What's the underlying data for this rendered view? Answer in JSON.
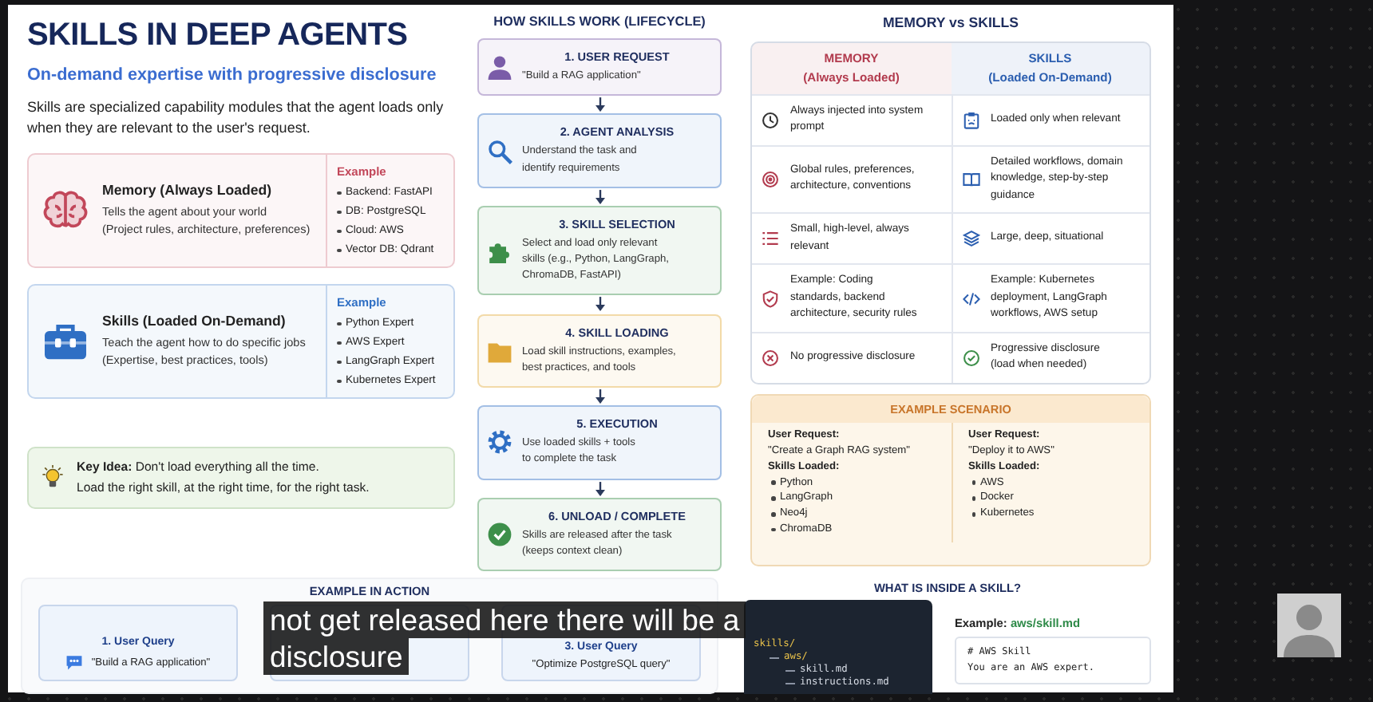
{
  "header": {
    "title": "SKILLS IN DEEP AGENTS",
    "subtitle": "On-demand expertise with progressive disclosure",
    "description": "Skills are specialized capability modules that the agent loads only when they are relevant to the user's request."
  },
  "concepts": [
    {
      "title": "Memory (Always Loaded)",
      "lines": [
        "Tells the agent about your world",
        "(Project rules, architecture, preferences)"
      ],
      "example_label": "Example",
      "examples": [
        "Backend: FastAPI",
        "DB: PostgreSQL",
        "Cloud: AWS",
        "Vector DB: Qdrant"
      ],
      "color": "#c2475a"
    },
    {
      "title": "Skills (Loaded On-Demand)",
      "lines": [
        "Teach the agent how to do specific jobs",
        "(Expertise, best practices, tools)"
      ],
      "example_label": "Example",
      "examples": [
        "Python Expert",
        "AWS Expert",
        "LangGraph Expert",
        "Kubernetes Expert"
      ],
      "color": "#2f6fc4"
    }
  ],
  "key_idea": {
    "lines": [
      "**Key Idea:**  Don't load everything all the time.",
      "Load the right skill, at the right time, for the right task."
    ]
  },
  "lifecycle": {
    "title": "HOW SKILLS WORK (LIFECYCLE)",
    "steps": [
      {
        "title": "1.  USER REQUEST",
        "lines": [
          "\"Build a RAG application\""
        ],
        "color": "#7a5ca8"
      },
      {
        "title": "2.  AGENT ANALYSIS",
        "lines": [
          "Understand the task and",
          "identify requirements"
        ],
        "color": "#2f6fc4"
      },
      {
        "title": "3.  SKILL SELECTION",
        "lines": [
          "Select and load only relevant",
          "skills (e.g., Python, LangGraph,",
          "ChromaDB, FastAPI)"
        ],
        "color": "#3d8f4a"
      },
      {
        "title": "4.  SKILL LOADING",
        "lines": [
          "Load skill instructions, examples,",
          "best practices, and tools"
        ],
        "color": "#e0a93a"
      },
      {
        "title": "5.  EXECUTION",
        "lines": [
          "Use loaded skills + tools",
          "to complete the task"
        ],
        "color": "#2f6fc4"
      },
      {
        "title": "6. UNLOAD / COMPLETE",
        "lines": [
          "Skills are released after the task",
          "(keeps context clean)"
        ],
        "color": "#3d8f4a"
      }
    ]
  },
  "comparison": {
    "title": "MEMORY vs SKILLS",
    "columns": [
      {
        "title": "MEMORY",
        "subtitle": "(Always Loaded)",
        "color": "#b23b4e"
      },
      {
        "title": "SKILLS",
        "subtitle": "(Loaded On-Demand)",
        "color": "#2c5fb0"
      }
    ],
    "rows": [
      {
        "memory": "Always injected into system prompt",
        "skills": "Loaded only when relevant"
      },
      {
        "memory": "Global rules, preferences, architecture, conventions",
        "skills": "Detailed workflows, domain knowledge, step-by-step guidance"
      },
      {
        "memory": "Small, high-level, always relevant",
        "skills": "Large, deep, situational"
      },
      {
        "memory": "Example: Coding standards, backend architecture, security rules",
        "skills": "Example: Kubernetes deployment, LangGraph workflows, AWS setup"
      },
      {
        "memory": "No progressive disclosure",
        "skills": "Progressive disclosure (load when needed)"
      }
    ]
  },
  "scenario": {
    "title": "EXAMPLE SCENARIO",
    "cases": [
      {
        "request_label": "User Request:",
        "request": "\"Create a Graph RAG system\"",
        "skills_label": "Skills Loaded:",
        "skills": [
          "Python",
          "LangGraph",
          "Neo4j",
          "ChromaDB"
        ]
      },
      {
        "request_label": "User Request:",
        "request": "\"Deploy it to AWS\"",
        "skills_label": "Skills Loaded:",
        "skills": [
          "AWS",
          "Docker",
          "Kubernetes"
        ]
      }
    ]
  },
  "example_in_action": {
    "title": "EXAMPLE IN ACTION",
    "queries": [
      {
        "title": "1. User Query",
        "text": "\"Build a RAG application\""
      },
      {
        "covered": true
      },
      {
        "title": "3. User Query",
        "text": "\"Optimize PostgreSQL query\""
      }
    ]
  },
  "skill_contents": {
    "title": "WHAT IS INSIDE A SKILL?",
    "tree": [
      {
        "name": "skills/",
        "children": [
          {
            "name": "aws/",
            "children": [
              {
                "name": "skill.md"
              },
              {
                "name": "instructions.md"
              }
            ]
          }
        ]
      }
    ],
    "example_label": "Example:",
    "example_file": "aws/skill.md",
    "code_lines": [
      "# AWS Skill",
      "You are an AWS expert."
    ]
  },
  "caption": {
    "lines": [
      "not get released here there will be a",
      "disclosure"
    ]
  }
}
